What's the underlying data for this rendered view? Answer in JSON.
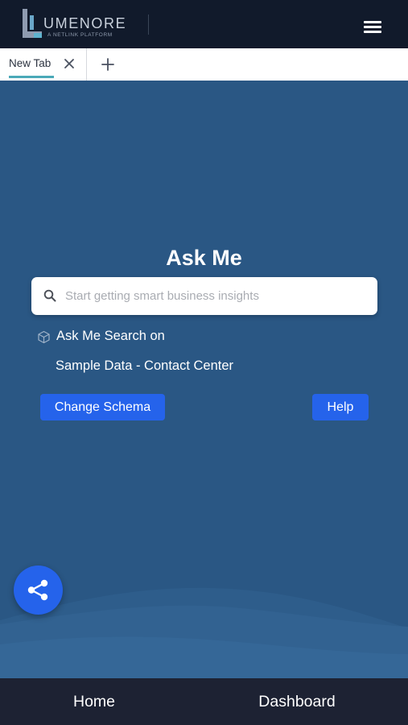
{
  "header": {
    "logo_word": "UMENORE",
    "logo_tagline": "A NETLINK PLATFORM",
    "menu_icon": "hamburger-menu-icon"
  },
  "tabs": {
    "items": [
      {
        "label": "New Tab",
        "active": true
      }
    ],
    "close_icon": "close-icon",
    "add_icon": "plus-icon"
  },
  "main": {
    "title": "Ask Me",
    "search": {
      "placeholder": "Start getting smart business insights",
      "value": "",
      "icon": "search-icon"
    },
    "search_on_label": "Ask Me Search on",
    "schema_icon": "cube-icon",
    "schema_name": "Sample Data - Contact Center",
    "change_schema_label": "Change Schema",
    "help_label": "Help"
  },
  "share_icon": "share-icon",
  "bottom_nav": {
    "home_label": "Home",
    "dashboard_label": "Dashboard"
  },
  "colors": {
    "background": "#2a5784",
    "header": "#111a2b",
    "accent_button": "#2563eb",
    "tab_underline": "#4aa9b8",
    "bottom_nav": "#1d2233"
  }
}
